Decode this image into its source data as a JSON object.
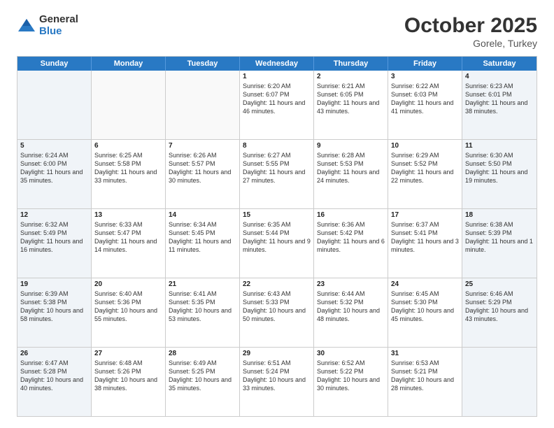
{
  "logo": {
    "general": "General",
    "blue": "Blue"
  },
  "header": {
    "month": "October 2025",
    "location": "Gorele, Turkey"
  },
  "weekdays": [
    "Sunday",
    "Monday",
    "Tuesday",
    "Wednesday",
    "Thursday",
    "Friday",
    "Saturday"
  ],
  "rows": [
    [
      {
        "day": "",
        "empty": true
      },
      {
        "day": "",
        "empty": true
      },
      {
        "day": "",
        "empty": true
      },
      {
        "day": "1",
        "sunrise": "Sunrise: 6:20 AM",
        "sunset": "Sunset: 6:07 PM",
        "daylight": "Daylight: 11 hours and 46 minutes."
      },
      {
        "day": "2",
        "sunrise": "Sunrise: 6:21 AM",
        "sunset": "Sunset: 6:05 PM",
        "daylight": "Daylight: 11 hours and 43 minutes."
      },
      {
        "day": "3",
        "sunrise": "Sunrise: 6:22 AM",
        "sunset": "Sunset: 6:03 PM",
        "daylight": "Daylight: 11 hours and 41 minutes."
      },
      {
        "day": "4",
        "sunrise": "Sunrise: 6:23 AM",
        "sunset": "Sunset: 6:01 PM",
        "daylight": "Daylight: 11 hours and 38 minutes."
      }
    ],
    [
      {
        "day": "5",
        "sunrise": "Sunrise: 6:24 AM",
        "sunset": "Sunset: 6:00 PM",
        "daylight": "Daylight: 11 hours and 35 minutes."
      },
      {
        "day": "6",
        "sunrise": "Sunrise: 6:25 AM",
        "sunset": "Sunset: 5:58 PM",
        "daylight": "Daylight: 11 hours and 33 minutes."
      },
      {
        "day": "7",
        "sunrise": "Sunrise: 6:26 AM",
        "sunset": "Sunset: 5:57 PM",
        "daylight": "Daylight: 11 hours and 30 minutes."
      },
      {
        "day": "8",
        "sunrise": "Sunrise: 6:27 AM",
        "sunset": "Sunset: 5:55 PM",
        "daylight": "Daylight: 11 hours and 27 minutes."
      },
      {
        "day": "9",
        "sunrise": "Sunrise: 6:28 AM",
        "sunset": "Sunset: 5:53 PM",
        "daylight": "Daylight: 11 hours and 24 minutes."
      },
      {
        "day": "10",
        "sunrise": "Sunrise: 6:29 AM",
        "sunset": "Sunset: 5:52 PM",
        "daylight": "Daylight: 11 hours and 22 minutes."
      },
      {
        "day": "11",
        "sunrise": "Sunrise: 6:30 AM",
        "sunset": "Sunset: 5:50 PM",
        "daylight": "Daylight: 11 hours and 19 minutes."
      }
    ],
    [
      {
        "day": "12",
        "sunrise": "Sunrise: 6:32 AM",
        "sunset": "Sunset: 5:49 PM",
        "daylight": "Daylight: 11 hours and 16 minutes."
      },
      {
        "day": "13",
        "sunrise": "Sunrise: 6:33 AM",
        "sunset": "Sunset: 5:47 PM",
        "daylight": "Daylight: 11 hours and 14 minutes."
      },
      {
        "day": "14",
        "sunrise": "Sunrise: 6:34 AM",
        "sunset": "Sunset: 5:45 PM",
        "daylight": "Daylight: 11 hours and 11 minutes."
      },
      {
        "day": "15",
        "sunrise": "Sunrise: 6:35 AM",
        "sunset": "Sunset: 5:44 PM",
        "daylight": "Daylight: 11 hours and 9 minutes."
      },
      {
        "day": "16",
        "sunrise": "Sunrise: 6:36 AM",
        "sunset": "Sunset: 5:42 PM",
        "daylight": "Daylight: 11 hours and 6 minutes."
      },
      {
        "day": "17",
        "sunrise": "Sunrise: 6:37 AM",
        "sunset": "Sunset: 5:41 PM",
        "daylight": "Daylight: 11 hours and 3 minutes."
      },
      {
        "day": "18",
        "sunrise": "Sunrise: 6:38 AM",
        "sunset": "Sunset: 5:39 PM",
        "daylight": "Daylight: 11 hours and 1 minute."
      }
    ],
    [
      {
        "day": "19",
        "sunrise": "Sunrise: 6:39 AM",
        "sunset": "Sunset: 5:38 PM",
        "daylight": "Daylight: 10 hours and 58 minutes."
      },
      {
        "day": "20",
        "sunrise": "Sunrise: 6:40 AM",
        "sunset": "Sunset: 5:36 PM",
        "daylight": "Daylight: 10 hours and 55 minutes."
      },
      {
        "day": "21",
        "sunrise": "Sunrise: 6:41 AM",
        "sunset": "Sunset: 5:35 PM",
        "daylight": "Daylight: 10 hours and 53 minutes."
      },
      {
        "day": "22",
        "sunrise": "Sunrise: 6:43 AM",
        "sunset": "Sunset: 5:33 PM",
        "daylight": "Daylight: 10 hours and 50 minutes."
      },
      {
        "day": "23",
        "sunrise": "Sunrise: 6:44 AM",
        "sunset": "Sunset: 5:32 PM",
        "daylight": "Daylight: 10 hours and 48 minutes."
      },
      {
        "day": "24",
        "sunrise": "Sunrise: 6:45 AM",
        "sunset": "Sunset: 5:30 PM",
        "daylight": "Daylight: 10 hours and 45 minutes."
      },
      {
        "day": "25",
        "sunrise": "Sunrise: 6:46 AM",
        "sunset": "Sunset: 5:29 PM",
        "daylight": "Daylight: 10 hours and 43 minutes."
      }
    ],
    [
      {
        "day": "26",
        "sunrise": "Sunrise: 6:47 AM",
        "sunset": "Sunset: 5:28 PM",
        "daylight": "Daylight: 10 hours and 40 minutes."
      },
      {
        "day": "27",
        "sunrise": "Sunrise: 6:48 AM",
        "sunset": "Sunset: 5:26 PM",
        "daylight": "Daylight: 10 hours and 38 minutes."
      },
      {
        "day": "28",
        "sunrise": "Sunrise: 6:49 AM",
        "sunset": "Sunset: 5:25 PM",
        "daylight": "Daylight: 10 hours and 35 minutes."
      },
      {
        "day": "29",
        "sunrise": "Sunrise: 6:51 AM",
        "sunset": "Sunset: 5:24 PM",
        "daylight": "Daylight: 10 hours and 33 minutes."
      },
      {
        "day": "30",
        "sunrise": "Sunrise: 6:52 AM",
        "sunset": "Sunset: 5:22 PM",
        "daylight": "Daylight: 10 hours and 30 minutes."
      },
      {
        "day": "31",
        "sunrise": "Sunrise: 6:53 AM",
        "sunset": "Sunset: 5:21 PM",
        "daylight": "Daylight: 10 hours and 28 minutes."
      },
      {
        "day": "",
        "empty": true
      }
    ]
  ]
}
